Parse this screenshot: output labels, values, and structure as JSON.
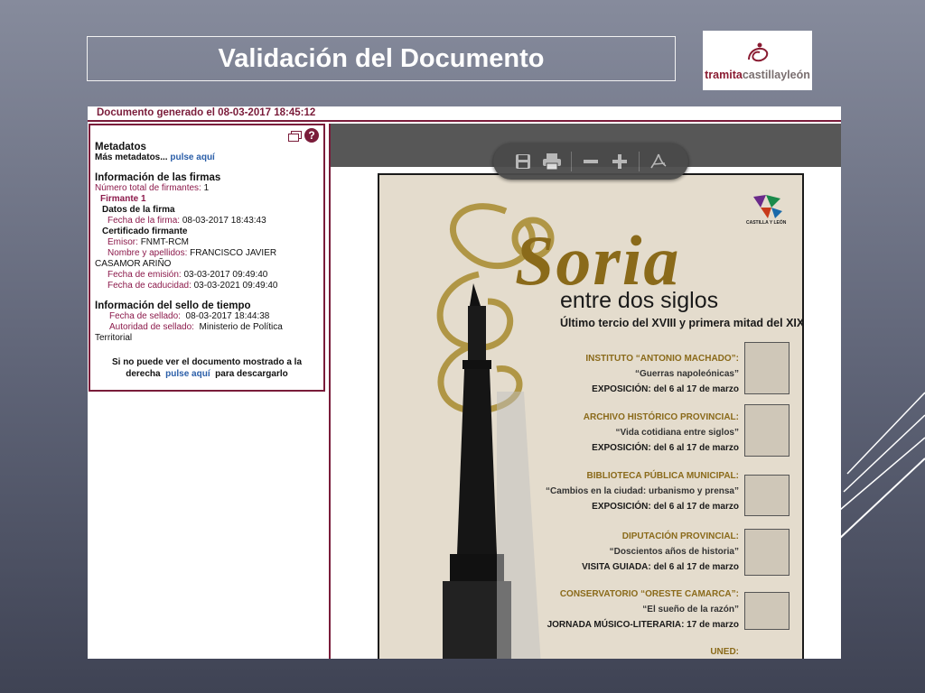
{
  "slide": {
    "title": "Validación del Documento",
    "logo": {
      "brand_bold": "tramita",
      "brand_rest": "castillayleón"
    }
  },
  "viewer": {
    "generated_label": "Documento generado el 08-03-2017 18:45:12",
    "toolbar_icons": [
      "save-icon",
      "print-icon",
      "zoom-out-icon",
      "zoom-in-icon",
      "acrobat-icon"
    ]
  },
  "panel": {
    "metadata_title": "Metadatos",
    "more_metadata": "Más metadatos...",
    "click_here": "pulse aquí",
    "signatures_title": "Información de las firmas",
    "total_signers_label": "Número total de firmantes:",
    "total_signers_value": "1",
    "signer": "Firmante 1",
    "signature_data": "Datos de la firma",
    "signature_date_label": "Fecha de la firma:",
    "signature_date_value": "08-03-2017 18:43:43",
    "cert_title": "Certificado firmante",
    "issuer_label": "Emisor:",
    "issuer_value": "FNMT-RCM",
    "name_label": "Nombre y apellidos:",
    "name_value_1": "FRANCISCO JAVIER",
    "name_value_2": "CASAMOR ARIÑO",
    "issue_date_label": "Fecha de emisión:",
    "issue_date_value": "03-03-2017 09:49:40",
    "expiry_label": "Fecha de caducidad:",
    "expiry_value": "03-03-2021 09:49:40",
    "timestamp_title": "Información del sello de tiempo",
    "stamp_date_label": "Fecha de sellado:",
    "stamp_date_value": "08-03-2017 18:44:38",
    "stamp_authority_label": "Autoridad de sellado:",
    "stamp_authority_value_1": "Ministerio de Política",
    "stamp_authority_value_2": "Territorial",
    "note_1": "Si no puede ver el documento mostrado a la",
    "note_2a": "derecha",
    "note_link": "pulse aquí",
    "note_2b": "para descargarlo"
  },
  "poster": {
    "title": "Soria",
    "subtitle": "entre dos siglos",
    "subtitle2": "Último tercio del XVIII y  primera mitad del XIX",
    "region_logo_text": "CASTILLA Y LEÓN",
    "events": [
      {
        "inst": "INSTITUTO “ANTONIO MACHADO”:",
        "desc": "“Guerras napoleónicas”",
        "when": "EXPOSICIÓN: del 6 al 17 de marzo"
      },
      {
        "inst": "ARCHIVO HISTÓRICO PROVINCIAL:",
        "desc": "“Vida cotidiana entre siglos”",
        "when": "EXPOSICIÓN: del 6 al 17 de marzo"
      },
      {
        "inst": "BIBLIOTECA PÚBLICA MUNICIPAL:",
        "desc": "“Cambios en la ciudad: urbanismo y prensa”",
        "when": "EXPOSICIÓN: del 6 al 17 de marzo"
      },
      {
        "inst": "DIPUTACIÓN PROVINCIAL:",
        "desc": "“Doscientos años de historia”",
        "when": "VISITA GUIADA: del 6 al  17 de marzo"
      },
      {
        "inst": "CONSERVATORIO “ORESTE CAMARCA”:",
        "desc": "“El sueño de la razón”",
        "when": "JORNADA MÚSICO-LITERARIA: 17 de marzo"
      },
      {
        "inst": "UNED:",
        "desc": "",
        "when": ""
      }
    ]
  }
}
